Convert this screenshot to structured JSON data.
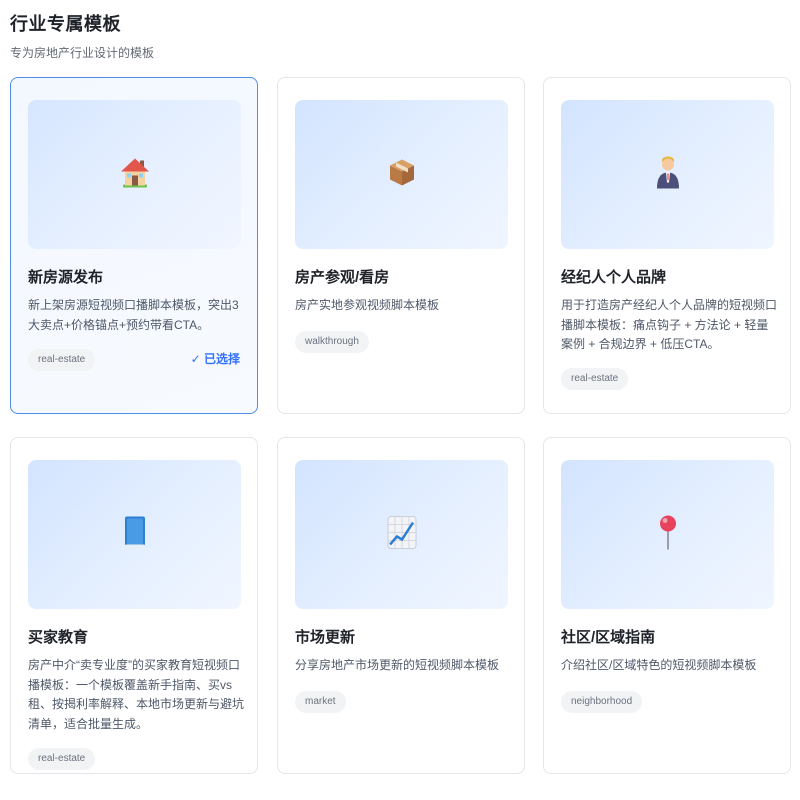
{
  "header": {
    "title": "行业专属模板",
    "subtitle": "专为房地产行业设计的模板"
  },
  "cards": [
    {
      "title": "新房源发布",
      "description": "新上架房源短视频口播脚本模板，突出3大卖点+价格锚点+预约带看CTA。",
      "tag": "real-estate",
      "icon": "house-icon",
      "selected": true,
      "selected_label": "✓ 已选择"
    },
    {
      "title": "房产参观/看房",
      "description": "房产实地参观视频脚本模板",
      "tag": "walkthrough",
      "icon": "package-icon",
      "selected": false
    },
    {
      "title": "经纪人个人品牌",
      "description": "用于打造房产经纪人个人品牌的短视频口播脚本模板：痛点钩子 + 方法论 + 轻量案例 + 合规边界 + 低压CTA。",
      "tag": "real-estate",
      "icon": "person-icon",
      "selected": false
    },
    {
      "title": "买家教育",
      "description": "房产中介“卖专业度”的买家教育短视频口播模板：一个模板覆盖新手指南、买vs租、按揭利率解释、本地市场更新与避坑清单，适合批量生成。",
      "tag": "real-estate",
      "icon": "book-icon",
      "selected": false
    },
    {
      "title": "市场更新",
      "description": "分享房地产市场更新的短视频脚本模板",
      "tag": "market",
      "icon": "chart-increasing-icon",
      "selected": false
    },
    {
      "title": "社区/区域指南",
      "description": "介绍社区/区域特色的短视频脚本模板",
      "tag": "neighborhood",
      "icon": "pushpin-icon",
      "selected": false
    }
  ]
}
